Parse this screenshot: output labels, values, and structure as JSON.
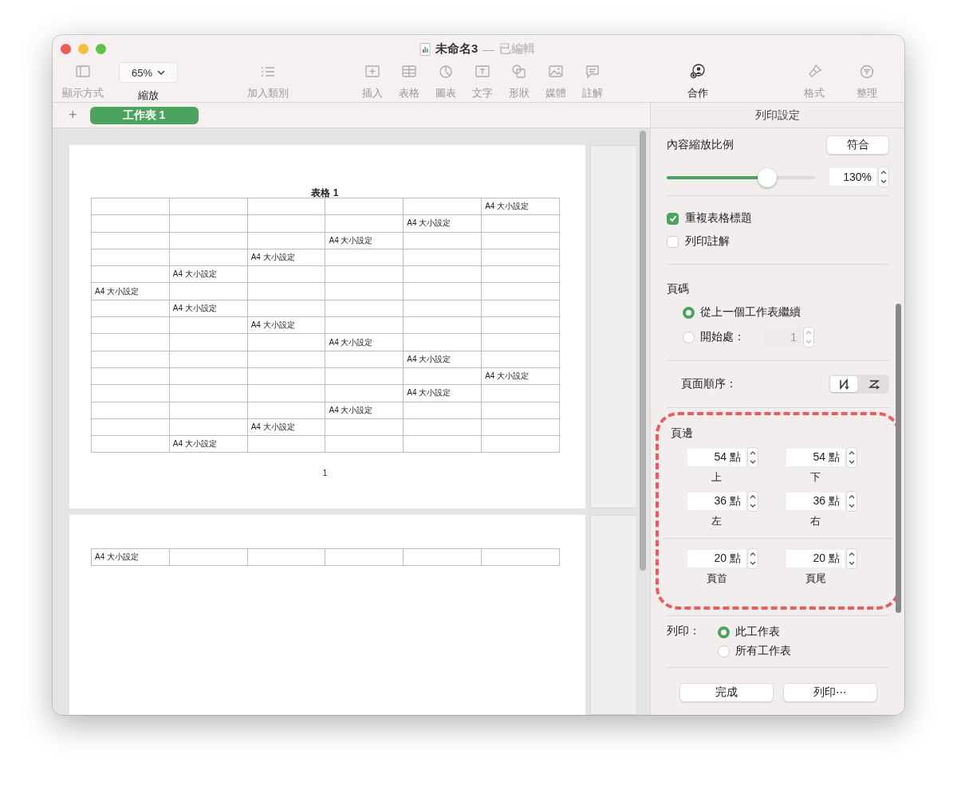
{
  "window": {
    "title": "未命名3",
    "separator": "—",
    "status": "已編輯"
  },
  "toolbar": [
    {
      "items": [
        {
          "kind": "sidebar",
          "label": "顯示方式",
          "disabled": true
        },
        {
          "kind": "dropdown",
          "value": "65%",
          "label": "縮放",
          "disabled": false
        }
      ]
    },
    {
      "items": [
        {
          "kind": "list",
          "label": "加入類別",
          "disabled": true
        }
      ]
    },
    {
      "items": [
        {
          "kind": "insert",
          "label": "插入",
          "disabled": true
        },
        {
          "kind": "table",
          "label": "表格",
          "disabled": true
        },
        {
          "kind": "chart",
          "label": "圖表",
          "disabled": true
        },
        {
          "kind": "text",
          "label": "文字",
          "disabled": true
        },
        {
          "kind": "shape",
          "label": "形狀",
          "disabled": true
        },
        {
          "kind": "media",
          "label": "媒體",
          "disabled": true
        },
        {
          "kind": "comment",
          "label": "註解",
          "disabled": true
        }
      ]
    },
    {
      "items": [
        {
          "kind": "collaborate",
          "label": "合作",
          "disabled": false
        }
      ]
    },
    {
      "items": [
        {
          "kind": "format",
          "label": "格式",
          "disabled": true
        },
        {
          "kind": "organize",
          "label": "整理",
          "disabled": true
        }
      ]
    }
  ],
  "sheet_tabs": {
    "add_button": "+",
    "tabs": [
      {
        "label": "工作表 1",
        "selected": true
      }
    ]
  },
  "pages": [
    {
      "title": "表格 1",
      "rows": [
        {
          "column_6": "A4 大小設定"
        },
        {
          "column_5": "A4 大小設定"
        },
        {
          "column_4": "A4 大小設定"
        },
        {
          "column_3": "A4 大小設定"
        },
        {
          "column_2": "A4 大小設定"
        },
        {
          "column_1": "A4 大小設定"
        },
        {
          "column_2": "A4 大小設定"
        },
        {
          "column_3": "A4 大小設定"
        },
        {
          "column_4": "A4 大小設定"
        },
        {
          "column_5": "A4 大小設定"
        },
        {
          "column_6": "A4 大小設定"
        },
        {
          "column_5": "A4 大小設定"
        },
        {
          "column_4": "A4 大小設定"
        },
        {
          "column_3": "A4 大小設定"
        },
        {
          "column_2": "A4 大小設定"
        }
      ],
      "page_number": "1"
    },
    {
      "rows": [
        {
          "column_1": "A4 大小設定"
        }
      ]
    }
  ],
  "print_settings": {
    "title": "列印設定",
    "scale": {
      "label": "內容縮放比例",
      "fit_button": "符合",
      "level": 0.68,
      "value": "130%"
    },
    "options": [
      {
        "label": "重複表格標題",
        "checked": true
      },
      {
        "label": "列印註解",
        "checked": false
      }
    ],
    "page_numbers": {
      "title": "頁碼",
      "options": [
        {
          "label": "從上一個工作表繼續",
          "selected": true
        },
        {
          "label": "開始處：",
          "selected": false,
          "field": "1",
          "field_disabled": true
        }
      ]
    },
    "page_order": {
      "label": "頁面順序：",
      "options": [
        {
          "kind": "down-then-over",
          "selected": true
        },
        {
          "kind": "over-then-down",
          "selected": false
        }
      ]
    },
    "margins": {
      "title": "頁邊",
      "highlighted": true,
      "fields": [
        {
          "value": "54 點",
          "label": "上"
        },
        {
          "value": "54 點",
          "label": "下"
        },
        {
          "value": "36 點",
          "label": "左"
        },
        {
          "value": "36 點",
          "label": "右"
        }
      ],
      "header_footer": [
        {
          "value": "20 點",
          "label": "頁首"
        },
        {
          "value": "20 點",
          "label": "頁尾"
        }
      ]
    },
    "print_scope": {
      "label": "列印：",
      "options": [
        {
          "label": "此工作表",
          "selected": true
        },
        {
          "label": "所有工作表",
          "selected": false
        }
      ]
    },
    "buttons": [
      "完成",
      "列印⋯"
    ]
  }
}
